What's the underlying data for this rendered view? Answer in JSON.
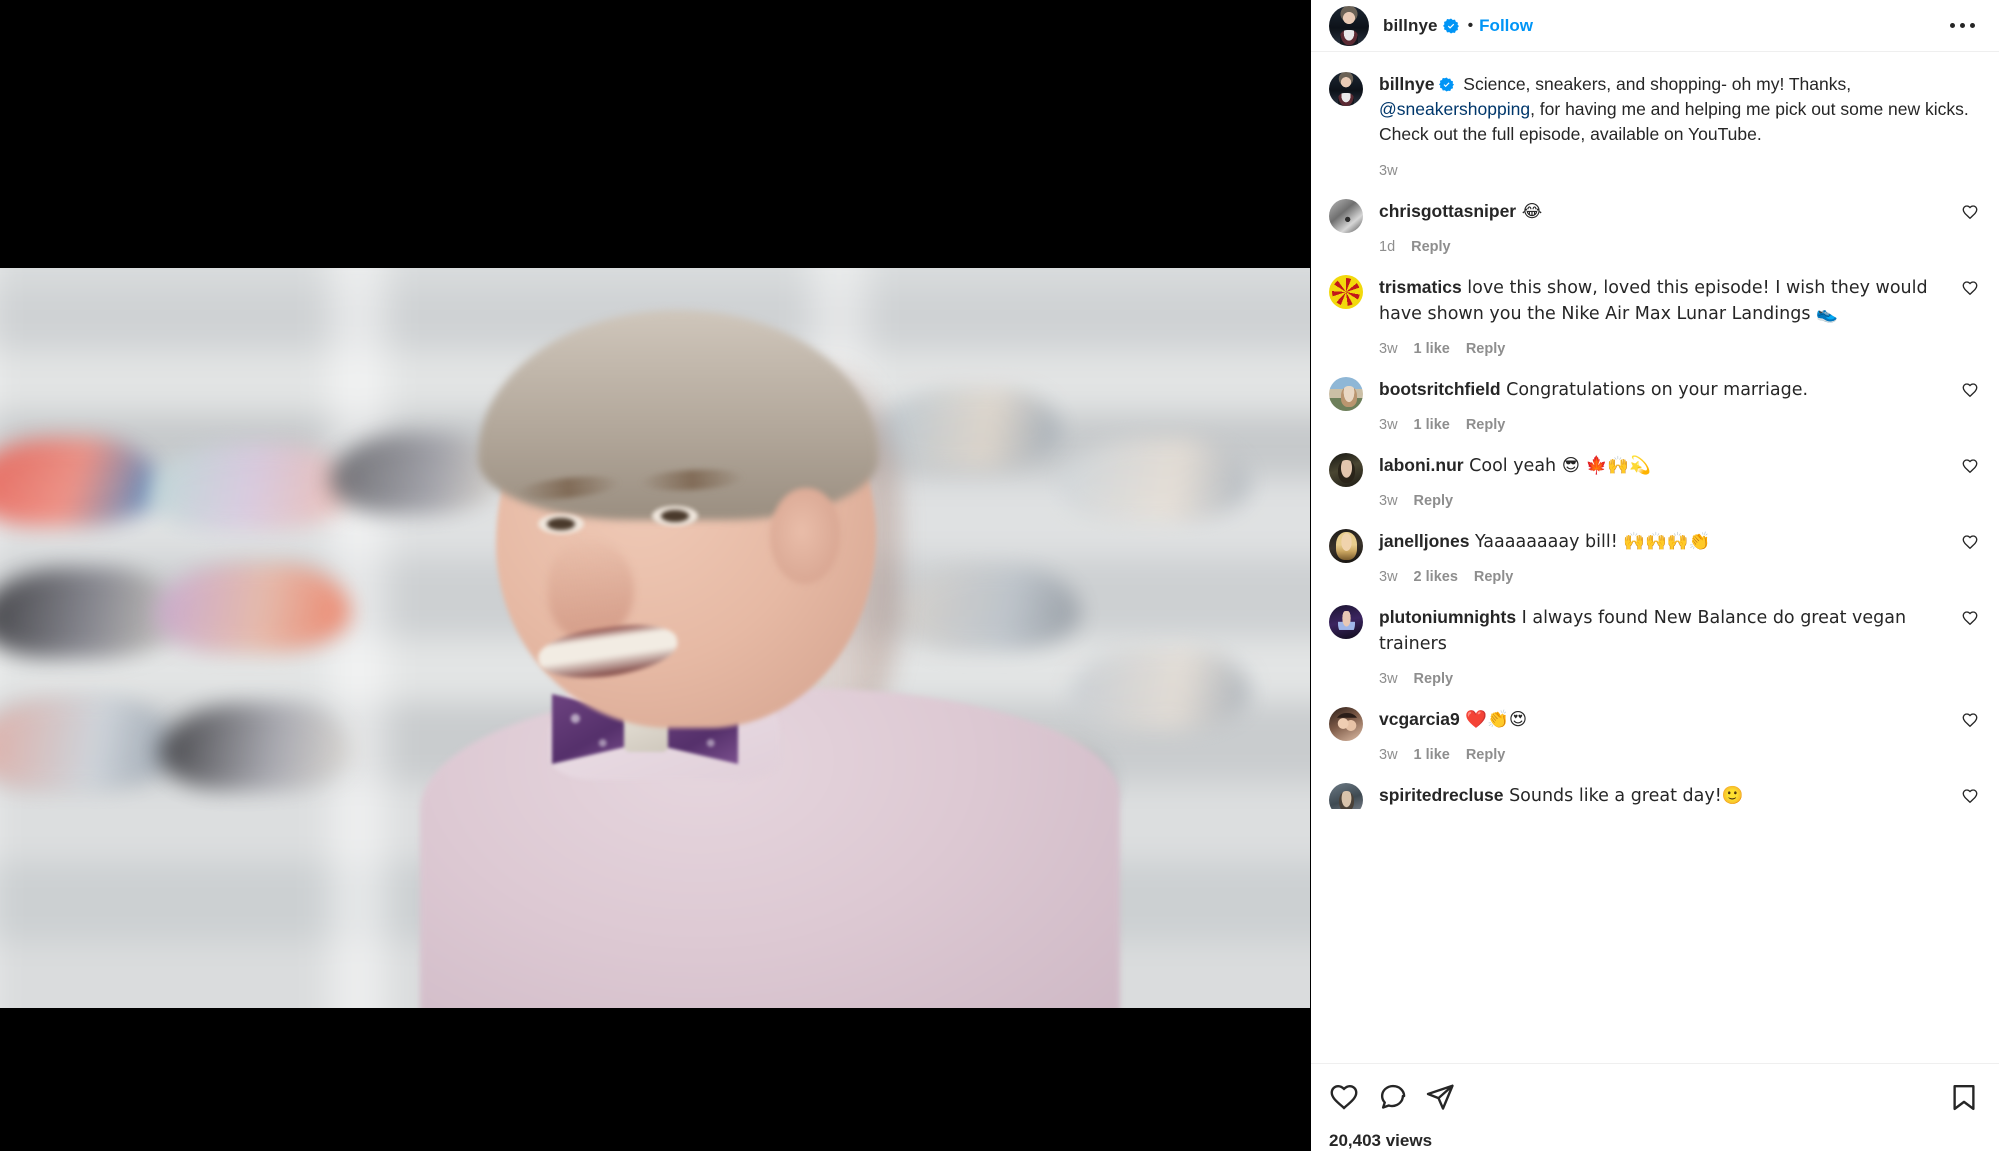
{
  "post": {
    "header": {
      "username": "billnye",
      "verified_badge": "verified-icon",
      "separator": "•",
      "follow_label": "Follow",
      "more_options": "more-options-icon"
    },
    "caption": {
      "username": "billnye",
      "text_before_mention": " Science, sneakers, and shopping- oh my! Thanks, ",
      "mention": "@sneakershopping",
      "text_after_mention": ", for having me and helping me pick out some new kicks. Check out the full episode, available on YouTube.",
      "timestamp": "3w"
    },
    "comments": [
      {
        "username": "chrisgottasniper",
        "text": " 😂",
        "timestamp": "1d",
        "likes": "",
        "reply_label": "Reply",
        "avatar": "av-sketch"
      },
      {
        "username": "trismatics",
        "text": " love this show, loved this episode! I wish they would have shown you the Nike Air Max Lunar Landings 👟",
        "timestamp": "3w",
        "likes": "1 like",
        "reply_label": "Reply",
        "avatar": "av-pentagram"
      },
      {
        "username": "bootsritchfield",
        "text": " Congratulations on your marriage.",
        "timestamp": "3w",
        "likes": "1 like",
        "reply_label": "Reply",
        "avatar": "av-boots"
      },
      {
        "username": "laboni.nur",
        "text": " Cool yeah 😎 🍁🙌💫",
        "timestamp": "3w",
        "likes": "",
        "reply_label": "Reply",
        "avatar": "av-laboni"
      },
      {
        "username": "janelljones",
        "text": " Yaaaaaaaay bill! 🙌🙌🙌👏",
        "timestamp": "3w",
        "likes": "2 likes",
        "reply_label": "Reply",
        "avatar": "av-janell"
      },
      {
        "username": "plutoniumnights",
        "text": " I always found New Balance do great vegan trainers",
        "timestamp": "3w",
        "likes": "",
        "reply_label": "Reply",
        "avatar": "av-pluto"
      },
      {
        "username": "vcgarcia9",
        "text": " ❤️👏😍",
        "timestamp": "3w",
        "likes": "1 like",
        "reply_label": "Reply",
        "avatar": "av-vcg"
      },
      {
        "username": "spiritedrecluse",
        "text": " Sounds like a great day!🙂",
        "timestamp": "",
        "likes": "",
        "reply_label": "",
        "avatar": "av-spirited"
      }
    ],
    "action_bar": {
      "like": "heart-icon",
      "comment": "comment-icon",
      "share": "share-icon",
      "save": "bookmark-icon",
      "likes_count": "20,403 views"
    },
    "media": {
      "type": "video",
      "description": "Bill Nye in a sneaker store wearing a lavender shirt and purple floral bow tie"
    },
    "colors": {
      "accent_blue": "#0095f6",
      "mention_blue": "#00376b",
      "text_primary": "#262626",
      "text_secondary": "#8e8e8e",
      "divider": "#efefef"
    }
  }
}
